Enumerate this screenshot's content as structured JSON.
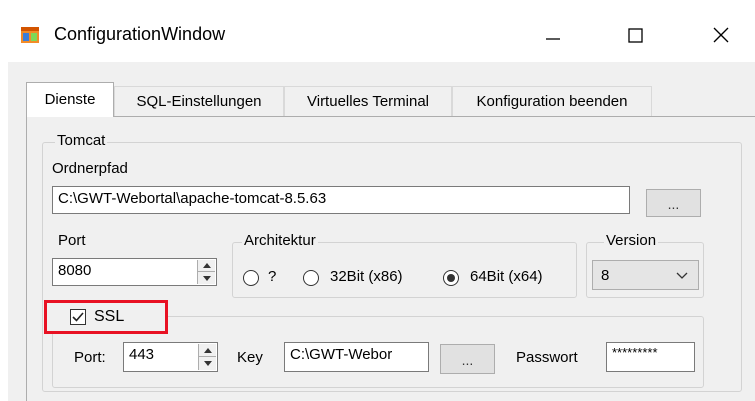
{
  "window": {
    "title": "ConfigurationWindow"
  },
  "tabs": [
    {
      "label": "Dienste"
    },
    {
      "label": "SQL-Einstellungen"
    },
    {
      "label": "Virtuelles Terminal"
    },
    {
      "label": "Konfiguration beenden"
    }
  ],
  "tomcat": {
    "group_label": "Tomcat",
    "folder_label": "Ordnerpfad",
    "folder_value": "C:\\GWT-Webortal\\apache-tomcat-8.5.63",
    "browse_label": "...",
    "port_label": "Port",
    "port_value": "8080",
    "architecture": {
      "label": "Architektur",
      "options": [
        {
          "label": "?",
          "selected": false
        },
        {
          "label": "32Bit (x86)",
          "selected": false
        },
        {
          "label": "64Bit (x64)",
          "selected": true
        }
      ]
    },
    "version": {
      "label": "Version",
      "selected": "8"
    }
  },
  "ssl": {
    "checkbox_label": "SSL",
    "checked": true,
    "port_label": "Port:",
    "port_value": "443",
    "key_label": "Key",
    "key_value": "C:\\GWT-Webor",
    "key_browse_label": "...",
    "password_label": "Passwort",
    "password_value": "*********"
  },
  "highlight_color": "#e81123"
}
